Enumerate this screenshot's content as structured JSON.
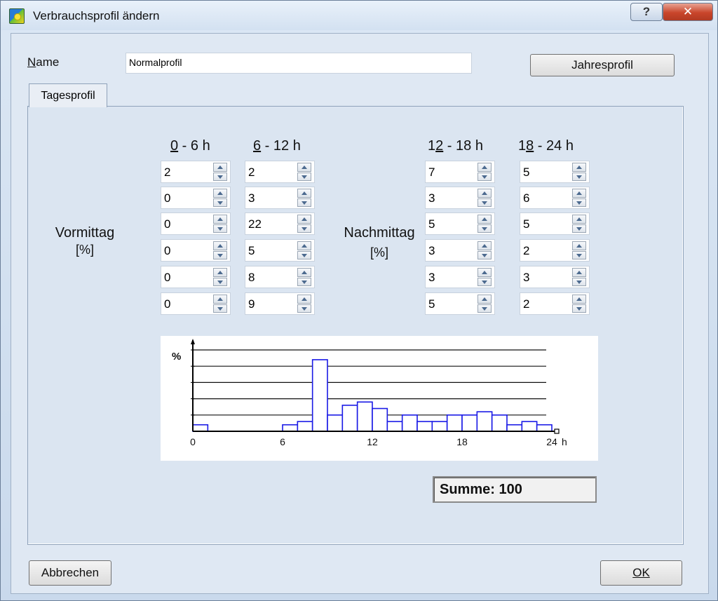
{
  "window": {
    "title": "Verbrauchsprofil ändern",
    "help_label": "?",
    "close_label": "✕"
  },
  "form": {
    "name_label": "Name",
    "name_value": "Normalprofil",
    "jahresprofil_label": "Jahresprofil"
  },
  "tab": {
    "label": "Tagesprofil"
  },
  "columns": [
    {
      "head_pre": "",
      "head_ul": "0",
      "head_post": " - 6 h",
      "values": [
        "2",
        "0",
        "0",
        "0",
        "0",
        "0"
      ]
    },
    {
      "head_pre": "",
      "head_ul": "6",
      "head_post": " - 12 h",
      "values": [
        "2",
        "3",
        "22",
        "5",
        "8",
        "9"
      ]
    },
    {
      "head_pre": "1",
      "head_ul": "2",
      "head_post": " - 18 h",
      "values": [
        "7",
        "3",
        "5",
        "3",
        "3",
        "5"
      ]
    },
    {
      "head_pre": "1",
      "head_ul": "8",
      "head_post": " - 24 h",
      "values": [
        "5",
        "6",
        "5",
        "2",
        "3",
        "2"
      ]
    }
  ],
  "labels": {
    "vormittag": "Vormittag",
    "vormittag_unit": "[%]",
    "nachmittag": "Nachmittag",
    "nachmittag_unit": "[%]"
  },
  "chart_data": {
    "type": "bar",
    "ylabel": "%",
    "xunit": "h",
    "xticks": [
      "0",
      "6",
      "12",
      "18",
      "24"
    ],
    "xlim": [
      0,
      24
    ],
    "ylim": [
      0,
      25
    ],
    "grid": true,
    "bar_color": "#1a1ae6",
    "categories": [
      "0",
      "1",
      "2",
      "3",
      "4",
      "5",
      "6",
      "7",
      "8",
      "9",
      "10",
      "11",
      "12",
      "13",
      "14",
      "15",
      "16",
      "17",
      "18",
      "19",
      "20",
      "21",
      "22",
      "23"
    ],
    "values": [
      2,
      0,
      0,
      0,
      0,
      0,
      2,
      3,
      22,
      5,
      8,
      9,
      7,
      3,
      5,
      3,
      3,
      5,
      5,
      6,
      5,
      2,
      3,
      2
    ]
  },
  "summe": {
    "label": "Summe: 100"
  },
  "buttons": {
    "abbrechen": "Abbrechen",
    "ok": "OK"
  }
}
